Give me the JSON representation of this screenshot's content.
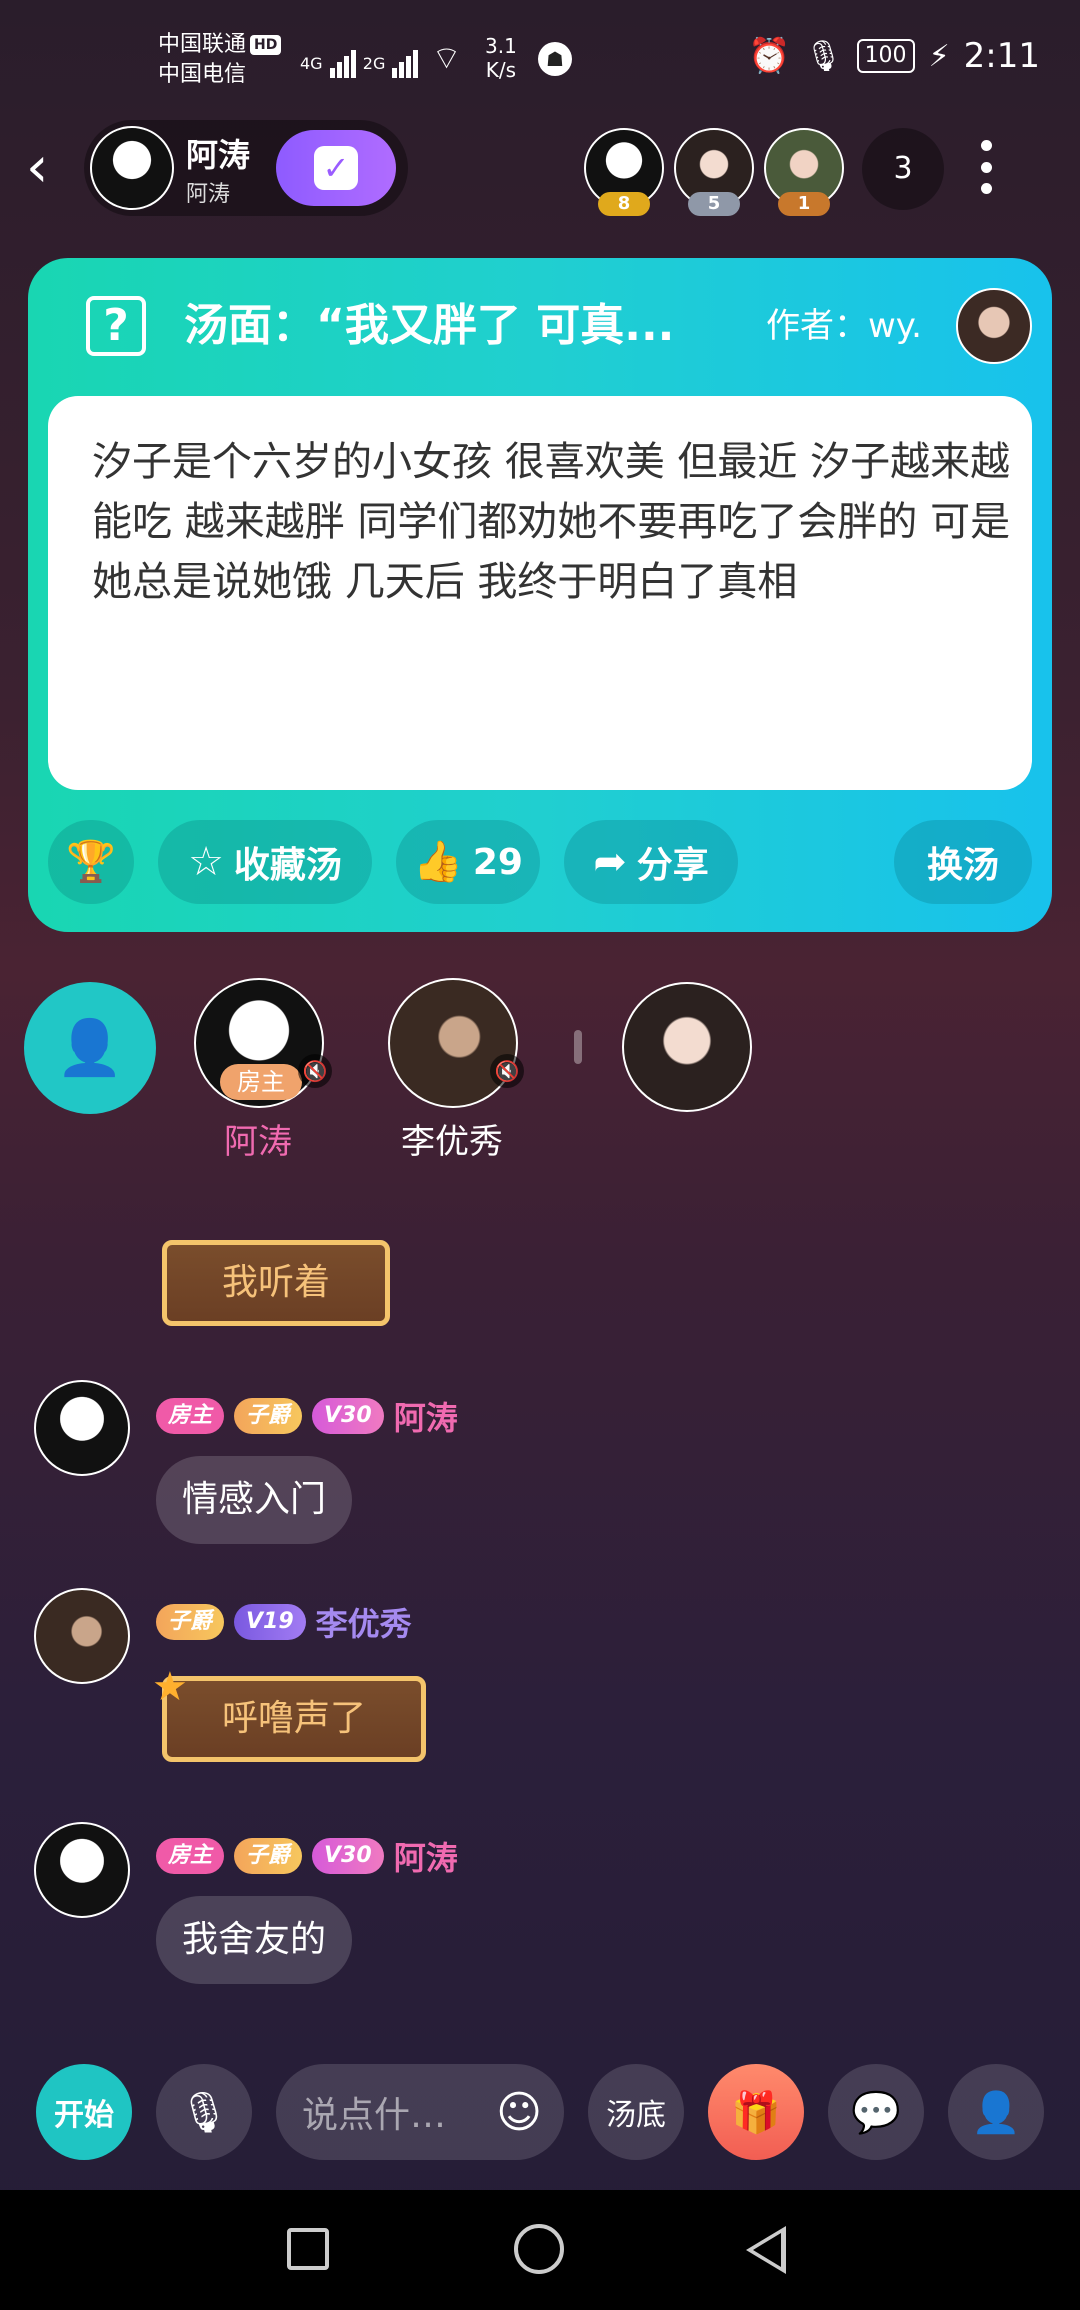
{
  "status_bar": {
    "carrier1": "中国联通",
    "hd": "HD",
    "carrier2": "中国电信",
    "net1": "4G",
    "net2": "2G",
    "speed_value": "3.1",
    "speed_unit": "K/s",
    "battery": "100",
    "time": "2:11"
  },
  "header": {
    "host_name": "阿涛",
    "host_sub": "阿涛",
    "viewers": [
      {
        "level": "8",
        "color": "#e0a91c"
      },
      {
        "level": "5",
        "color": "#8f98a8"
      },
      {
        "level": "1",
        "color": "#c8782c"
      }
    ],
    "viewer_count": "3"
  },
  "puzzle": {
    "title": "汤面：“我又胖了 可真...",
    "author": "作者：wy.",
    "body": "汐子是个六岁的小女孩 很喜欢美 但最近 汐子越来越能吃 越来越胖 同学们都劝她不要再吃了会胖的 可是她总是说她饿 几天后 我终于明白了真相",
    "favorite_label": "收藏汤",
    "likes": "29",
    "share_label": "分享",
    "switch_label": "换汤"
  },
  "seats": {
    "owner_tag": "房主",
    "seat1_name": "阿涛",
    "seat2_name": "李优秀"
  },
  "chat": {
    "gift1_text": "我听着",
    "msg1": {
      "tag_owner": "房主",
      "tag_noble": "子爵",
      "tag_vip": "V30",
      "name": "阿涛",
      "text": "情感入门"
    },
    "msg2": {
      "tag_noble": "子爵",
      "tag_vip": "V19",
      "name": "李优秀",
      "gift_text": "呼噜声了"
    },
    "msg3": {
      "tag_owner": "房主",
      "tag_noble": "子爵",
      "tag_vip": "V30",
      "name": "阿涛",
      "text": "我舍友的"
    }
  },
  "toolbar": {
    "start_label": "开始",
    "input_placeholder": "说点什…",
    "answer_label": "汤底"
  },
  "colors": {
    "accent_teal": "#1fc5c3",
    "name_pink": "#f06ab0",
    "name_purple": "#a58af0",
    "card_gradient_start": "#19d6b2",
    "card_gradient_end": "#18c2ec"
  }
}
